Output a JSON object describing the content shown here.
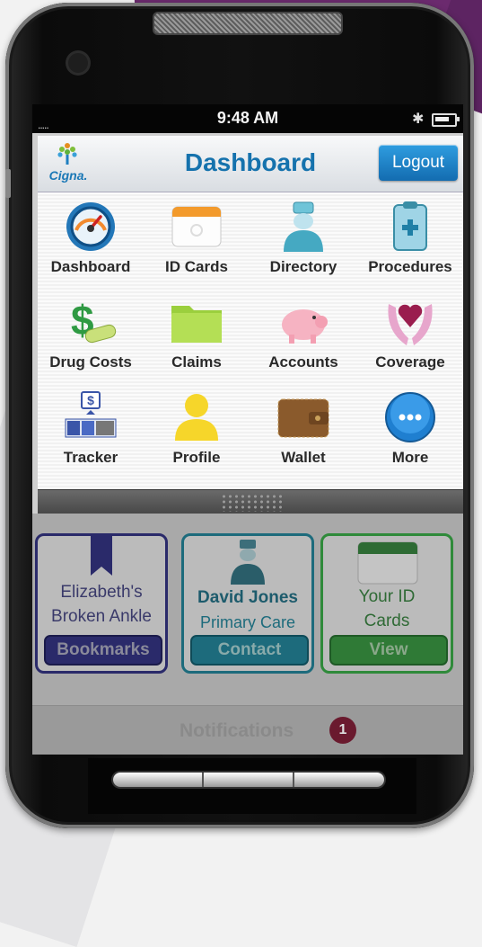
{
  "status_bar": {
    "time": "9:48 AM",
    "carrier": "....."
  },
  "nav": {
    "logo_text": "Cigna.",
    "title": "Dashboard",
    "logout_label": "Logout"
  },
  "menu": [
    {
      "label": "Dashboard",
      "icon": "speedometer-icon"
    },
    {
      "label": "ID Cards",
      "icon": "id-card-icon"
    },
    {
      "label": "Directory",
      "icon": "doctor-icon"
    },
    {
      "label": "Procedures",
      "icon": "clipboard-medical-icon"
    },
    {
      "label": "Drug Costs",
      "icon": "pill-dollar-icon"
    },
    {
      "label": "Claims",
      "icon": "folder-icon"
    },
    {
      "label": "Accounts",
      "icon": "piggy-bank-icon"
    },
    {
      "label": "Coverage",
      "icon": "hands-heart-icon"
    },
    {
      "label": "Tracker",
      "icon": "tracker-icon"
    },
    {
      "label": "Profile",
      "icon": "person-icon"
    },
    {
      "label": "Wallet",
      "icon": "wallet-icon"
    },
    {
      "label": "More",
      "icon": "more-icon"
    }
  ],
  "cards": [
    {
      "line1": "Elizabeth's",
      "line2": "Broken Ankle",
      "button": "Bookmarks"
    },
    {
      "line1": "David Jones",
      "line2": "Primary Care",
      "button": "Contact"
    },
    {
      "line1": "Your ID",
      "line2": "Cards",
      "button": "View"
    }
  ],
  "notifications": {
    "label": "Notifications",
    "count": "1"
  },
  "colors": {
    "accent": "#1572ad",
    "logout": "#1e86cf",
    "bookmarks": "#2a2a6a",
    "contact": "#1d6b7c",
    "view": "#2f8a3a"
  }
}
